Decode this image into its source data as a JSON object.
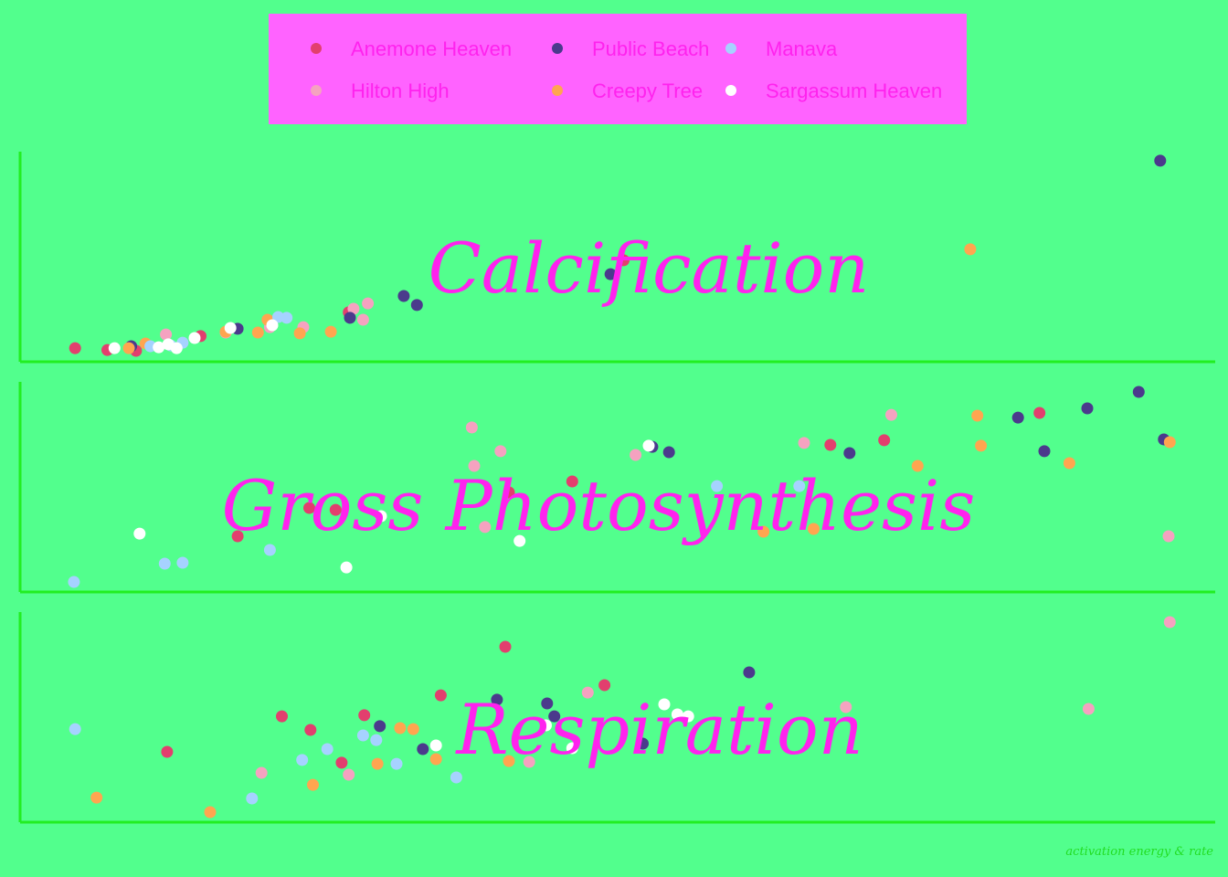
{
  "colors": {
    "background": "#52ff8d",
    "legend_box": "#ff63ff",
    "axis_line": "#22ee22",
    "facet_title": "#ff22ee",
    "legend_text": "#ff22ee",
    "caption_text": "#22dd22"
  },
  "caption": "activation energy & rate",
  "chart_data": {
    "type": "scatter",
    "layout": "three vertically stacked facets sharing x axis; no tick labels shown",
    "legend_position": "top-center",
    "grid": false,
    "series_names": [
      "Anemone Heaven",
      "Hilton High",
      "Public Beach",
      "Creepy Tree",
      "Manava",
      "Sargassum Heaven"
    ],
    "series_colors": [
      "#e23f6e",
      "#f5a2c0",
      "#4b3a8c",
      "#ffa550",
      "#a6d2ff",
      "#ffffff"
    ],
    "x_range": [
      0,
      100
    ],
    "y_range": [
      0,
      100
    ],
    "facets": [
      {
        "title": "Calcification",
        "points": [
          {
            "s": 0,
            "x": 4.6,
            "y": 6.5
          },
          {
            "s": 0,
            "x": 7.3,
            "y": 5.6
          },
          {
            "s": 0,
            "x": 9.7,
            "y": 5.2
          },
          {
            "s": 0,
            "x": 15.1,
            "y": 12.2
          },
          {
            "s": 0,
            "x": 27.5,
            "y": 23.5
          },
          {
            "s": 0,
            "x": 50.5,
            "y": 48.3
          },
          {
            "s": 1,
            "x": 12.2,
            "y": 13.0
          },
          {
            "s": 1,
            "x": 17.2,
            "y": 13.9
          },
          {
            "s": 1,
            "x": 20.9,
            "y": 16.5
          },
          {
            "s": 1,
            "x": 23.7,
            "y": 16.5
          },
          {
            "s": 1,
            "x": 27.9,
            "y": 25.2
          },
          {
            "s": 1,
            "x": 28.7,
            "y": 20.0
          },
          {
            "s": 1,
            "x": 29.1,
            "y": 27.8
          },
          {
            "s": 2,
            "x": 9.3,
            "y": 7.4
          },
          {
            "s": 2,
            "x": 18.2,
            "y": 15.7
          },
          {
            "s": 2,
            "x": 27.6,
            "y": 20.9
          },
          {
            "s": 2,
            "x": 32.1,
            "y": 31.3
          },
          {
            "s": 2,
            "x": 33.2,
            "y": 27.0
          },
          {
            "s": 2,
            "x": 49.4,
            "y": 41.7
          },
          {
            "s": 2,
            "x": 95.4,
            "y": 95.7
          },
          {
            "s": 3,
            "x": 9.1,
            "y": 6.5
          },
          {
            "s": 3,
            "x": 10.5,
            "y": 8.7
          },
          {
            "s": 3,
            "x": 17.2,
            "y": 14.3
          },
          {
            "s": 3,
            "x": 19.9,
            "y": 13.9
          },
          {
            "s": 3,
            "x": 20.7,
            "y": 20.0
          },
          {
            "s": 3,
            "x": 23.4,
            "y": 13.5
          },
          {
            "s": 3,
            "x": 26.0,
            "y": 14.3
          },
          {
            "s": 3,
            "x": 79.5,
            "y": 53.5
          },
          {
            "s": 4,
            "x": 10.9,
            "y": 7.4
          },
          {
            "s": 4,
            "x": 12.6,
            "y": 7.8
          },
          {
            "s": 4,
            "x": 13.6,
            "y": 9.1
          },
          {
            "s": 4,
            "x": 21.6,
            "y": 21.3
          },
          {
            "s": 4,
            "x": 22.3,
            "y": 20.9
          },
          {
            "s": 5,
            "x": 7.9,
            "y": 6.5
          },
          {
            "s": 5,
            "x": 11.6,
            "y": 6.9
          },
          {
            "s": 5,
            "x": 12.4,
            "y": 8.3
          },
          {
            "s": 5,
            "x": 13.1,
            "y": 6.5
          },
          {
            "s": 5,
            "x": 14.6,
            "y": 11.3
          },
          {
            "s": 5,
            "x": 17.6,
            "y": 16.1
          },
          {
            "s": 5,
            "x": 21.1,
            "y": 17.4
          }
        ]
      },
      {
        "title": "Gross Photosynthesis",
        "points": [
          {
            "s": 0,
            "x": 18.2,
            "y": 26.5
          },
          {
            "s": 0,
            "x": 24.2,
            "y": 40.0
          },
          {
            "s": 0,
            "x": 26.4,
            "y": 39.1
          },
          {
            "s": 0,
            "x": 40.9,
            "y": 47.4
          },
          {
            "s": 0,
            "x": 46.2,
            "y": 52.6
          },
          {
            "s": 0,
            "x": 67.8,
            "y": 70.0
          },
          {
            "s": 0,
            "x": 72.3,
            "y": 72.2
          },
          {
            "s": 0,
            "x": 85.3,
            "y": 85.2
          },
          {
            "s": 1,
            "x": 37.8,
            "y": 78.3
          },
          {
            "s": 1,
            "x": 38.0,
            "y": 60.0
          },
          {
            "s": 1,
            "x": 38.9,
            "y": 30.9
          },
          {
            "s": 1,
            "x": 40.2,
            "y": 67.0
          },
          {
            "s": 1,
            "x": 51.5,
            "y": 65.2
          },
          {
            "s": 1,
            "x": 65.6,
            "y": 70.9
          },
          {
            "s": 1,
            "x": 72.9,
            "y": 84.3
          },
          {
            "s": 1,
            "x": 96.1,
            "y": 26.5
          },
          {
            "s": 2,
            "x": 52.9,
            "y": 69.1
          },
          {
            "s": 2,
            "x": 54.3,
            "y": 66.5
          },
          {
            "s": 2,
            "x": 69.4,
            "y": 66.1
          },
          {
            "s": 2,
            "x": 83.5,
            "y": 83.0
          },
          {
            "s": 2,
            "x": 85.7,
            "y": 67.0
          },
          {
            "s": 2,
            "x": 89.3,
            "y": 87.4
          },
          {
            "s": 2,
            "x": 93.6,
            "y": 95.2
          },
          {
            "s": 2,
            "x": 95.7,
            "y": 72.6
          },
          {
            "s": 3,
            "x": 62.2,
            "y": 28.7
          },
          {
            "s": 3,
            "x": 66.4,
            "y": 30.0
          },
          {
            "s": 3,
            "x": 75.1,
            "y": 60.0
          },
          {
            "s": 3,
            "x": 80.1,
            "y": 83.9
          },
          {
            "s": 3,
            "x": 80.4,
            "y": 69.6
          },
          {
            "s": 3,
            "x": 87.8,
            "y": 61.3
          },
          {
            "s": 3,
            "x": 96.2,
            "y": 71.3
          },
          {
            "s": 4,
            "x": 4.5,
            "y": 4.8
          },
          {
            "s": 4,
            "x": 12.1,
            "y": 13.5
          },
          {
            "s": 4,
            "x": 13.6,
            "y": 13.9
          },
          {
            "s": 4,
            "x": 20.9,
            "y": 20.0
          },
          {
            "s": 4,
            "x": 58.3,
            "y": 50.4
          },
          {
            "s": 4,
            "x": 65.2,
            "y": 50.4
          },
          {
            "s": 5,
            "x": 10.0,
            "y": 27.8
          },
          {
            "s": 5,
            "x": 27.3,
            "y": 11.7
          },
          {
            "s": 5,
            "x": 30.2,
            "y": 36.1
          },
          {
            "s": 5,
            "x": 41.8,
            "y": 24.3
          },
          {
            "s": 5,
            "x": 52.6,
            "y": 69.6
          }
        ]
      },
      {
        "title": "Respiration",
        "points": [
          {
            "s": 0,
            "x": 12.3,
            "y": 33.5
          },
          {
            "s": 0,
            "x": 21.9,
            "y": 50.4
          },
          {
            "s": 0,
            "x": 24.3,
            "y": 43.9
          },
          {
            "s": 0,
            "x": 26.9,
            "y": 28.3
          },
          {
            "s": 0,
            "x": 28.8,
            "y": 50.9
          },
          {
            "s": 0,
            "x": 35.2,
            "y": 60.4
          },
          {
            "s": 0,
            "x": 40.6,
            "y": 83.5
          },
          {
            "s": 0,
            "x": 48.9,
            "y": 65.2
          },
          {
            "s": 1,
            "x": 20.2,
            "y": 23.5
          },
          {
            "s": 1,
            "x": 27.5,
            "y": 22.6
          },
          {
            "s": 1,
            "x": 42.6,
            "y": 28.7
          },
          {
            "s": 1,
            "x": 47.5,
            "y": 61.7
          },
          {
            "s": 1,
            "x": 69.1,
            "y": 54.8
          },
          {
            "s": 1,
            "x": 89.4,
            "y": 53.9
          },
          {
            "s": 1,
            "x": 96.2,
            "y": 95.2
          },
          {
            "s": 2,
            "x": 30.1,
            "y": 45.7
          },
          {
            "s": 2,
            "x": 33.7,
            "y": 34.8
          },
          {
            "s": 2,
            "x": 39.9,
            "y": 58.3
          },
          {
            "s": 2,
            "x": 44.1,
            "y": 56.5
          },
          {
            "s": 2,
            "x": 44.7,
            "y": 50.4
          },
          {
            "s": 2,
            "x": 52.1,
            "y": 37.4
          },
          {
            "s": 2,
            "x": 61.0,
            "y": 71.3
          },
          {
            "s": 3,
            "x": 6.4,
            "y": 11.7
          },
          {
            "s": 3,
            "x": 15.9,
            "y": 4.8
          },
          {
            "s": 3,
            "x": 24.5,
            "y": 17.8
          },
          {
            "s": 3,
            "x": 29.9,
            "y": 27.8
          },
          {
            "s": 3,
            "x": 31.8,
            "y": 44.8
          },
          {
            "s": 3,
            "x": 32.9,
            "y": 44.3
          },
          {
            "s": 3,
            "x": 34.8,
            "y": 30.0
          },
          {
            "s": 3,
            "x": 40.9,
            "y": 29.1
          },
          {
            "s": 4,
            "x": 4.6,
            "y": 44.3
          },
          {
            "s": 4,
            "x": 19.4,
            "y": 11.3
          },
          {
            "s": 4,
            "x": 23.6,
            "y": 29.6
          },
          {
            "s": 4,
            "x": 25.7,
            "y": 34.8
          },
          {
            "s": 4,
            "x": 28.7,
            "y": 41.3
          },
          {
            "s": 4,
            "x": 29.8,
            "y": 39.1
          },
          {
            "s": 4,
            "x": 31.5,
            "y": 27.8
          },
          {
            "s": 4,
            "x": 36.5,
            "y": 21.3
          },
          {
            "s": 5,
            "x": 34.8,
            "y": 36.5
          },
          {
            "s": 5,
            "x": 44.0,
            "y": 46.1
          },
          {
            "s": 5,
            "x": 46.2,
            "y": 35.2
          },
          {
            "s": 5,
            "x": 53.9,
            "y": 56.1
          },
          {
            "s": 5,
            "x": 55.0,
            "y": 51.3
          },
          {
            "s": 5,
            "x": 55.9,
            "y": 50.4
          }
        ]
      }
    ]
  }
}
